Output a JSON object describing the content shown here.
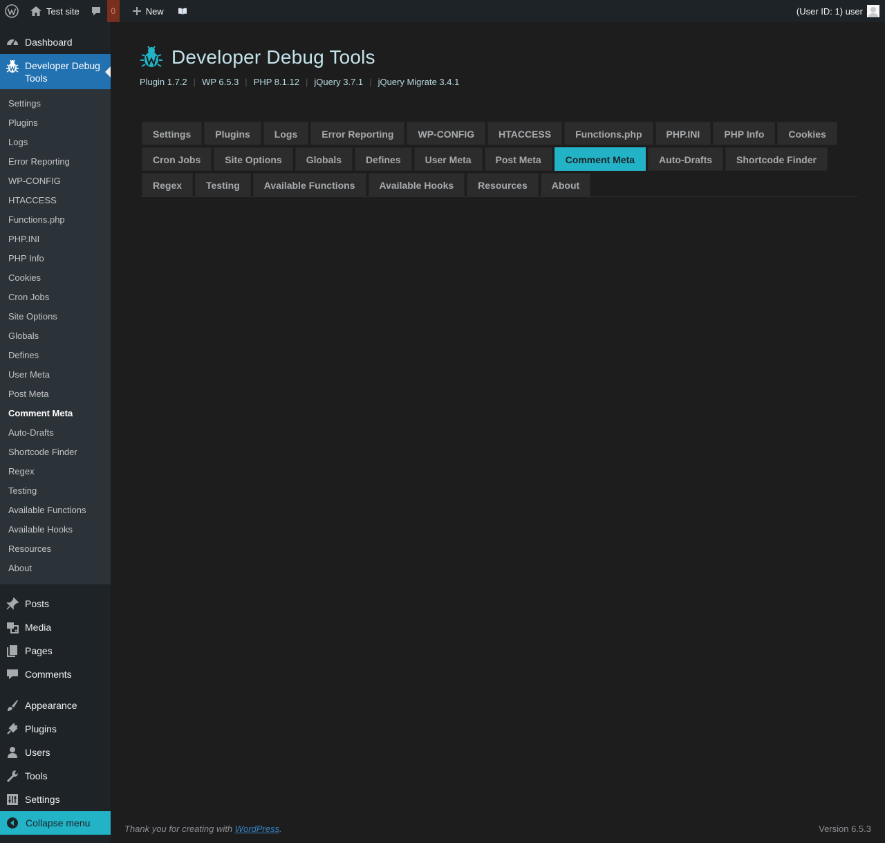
{
  "adminbar": {
    "site_name": "Test site",
    "comment_count": "0",
    "new_label": "New",
    "account": "(User ID: 1) user"
  },
  "sidebar": {
    "dashboard": "Dashboard",
    "current_menu": "Developer Debug Tools",
    "submenu": [
      "Settings",
      "Plugins",
      "Logs",
      "Error Reporting",
      "WP-CONFIG",
      "HTACCESS",
      "Functions.php",
      "PHP.INI",
      "PHP Info",
      "Cookies",
      "Cron Jobs",
      "Site Options",
      "Globals",
      "Defines",
      "User Meta",
      "Post Meta",
      "Comment Meta",
      "Auto-Drafts",
      "Shortcode Finder",
      "Regex",
      "Testing",
      "Available Functions",
      "Available Hooks",
      "Resources",
      "About"
    ],
    "active_submenu": "Comment Meta",
    "group2": [
      "Posts",
      "Media",
      "Pages",
      "Comments"
    ],
    "group3": [
      "Appearance",
      "Plugins",
      "Users",
      "Tools",
      "Settings"
    ],
    "collapse": "Collapse menu"
  },
  "main": {
    "title": "Developer Debug Tools",
    "versions": [
      "Plugin 1.7.2",
      "WP 6.5.3",
      "PHP 8.1.12",
      "jQuery 3.7.1",
      "jQuery Migrate 3.4.1"
    ],
    "tab_rows": [
      [
        "Settings",
        "Plugins",
        "Logs",
        "Error Reporting",
        "WP-CONFIG",
        "HTACCESS",
        "Functions.php",
        "PHP.INI",
        "PHP Info",
        "Cookies"
      ],
      [
        "Cron Jobs",
        "Site Options",
        "Globals",
        "Defines",
        "User Meta",
        "Post Meta",
        "Comment Meta",
        "Auto-Drafts",
        "Shortcode Finder"
      ],
      [
        "Regex",
        "Testing",
        "Available Functions",
        "Available Hooks",
        "Resources",
        "About"
      ]
    ],
    "active_tab": "Comment Meta"
  },
  "footer": {
    "thanks_prefix": "Thank you for creating with ",
    "thanks_link": "WordPress",
    "thanks_suffix": ".",
    "version": "Version 6.5.3"
  },
  "colors": {
    "accent": "#22b3c6",
    "admin_blue": "#2271b1",
    "sidebar_bg": "#1d2327",
    "submenu_bg": "#2c3338",
    "page_bg": "#1d1d1d"
  }
}
